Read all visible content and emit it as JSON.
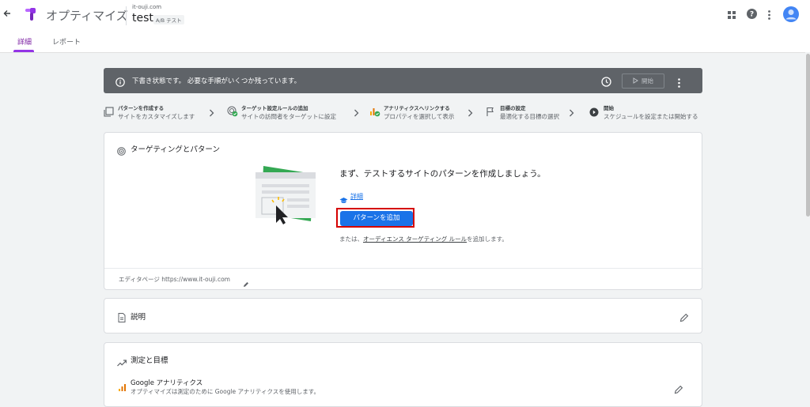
{
  "app": {
    "name": "オプティマイズ",
    "domain": "it-ouji.com",
    "experiment_name": "test",
    "experiment_type": "A/B テスト"
  },
  "tabs": [
    {
      "label": "詳細",
      "active": true
    },
    {
      "label": "レポート",
      "active": false
    }
  ],
  "banner": {
    "message": "下書き状態です。 必要な手順がいくつか残っています。",
    "start_label": "開始"
  },
  "steps": [
    {
      "title": "パターンを作成する",
      "desc": "サイトをカスタマイズします",
      "icon": "pattern-icon"
    },
    {
      "title": "ターゲット設定ルールの追加",
      "desc": "サイトの訪問者をターゲットに設定",
      "icon": "target-check-icon"
    },
    {
      "title": "アナリティクスへリンクする",
      "desc": "プロパティを選択して表示",
      "icon": "analytics-check-icon"
    },
    {
      "title": "目標の設定",
      "desc": "最適化する目標の選択",
      "icon": "flag-icon"
    },
    {
      "title": "開始",
      "desc": "スケジュールを設定または開始する",
      "icon": "play-circle-icon"
    }
  ],
  "targeting_card": {
    "title": "ターゲティングとパターン",
    "heading": "まず、テストするサイトのパターンを作成しましょう。",
    "detail_link": "詳細",
    "add_button": "パターンを追加",
    "or_prefix": "または、",
    "or_link": "オーディエンス ターゲティング ルール",
    "or_suffix": "を追加します。",
    "editor_page": "エディタページ https://www.it-ouji.com"
  },
  "description_card": {
    "title": "説明"
  },
  "measure_card": {
    "title": "測定と目標",
    "ga_title": "Google アナリティクス",
    "ga_desc": "オプティマイズは測定のために Google アナリティクスを使用します。"
  },
  "colors": {
    "brand_purple": "#9334e6",
    "primary_blue": "#1a73e8",
    "banner_gray": "#5f6368",
    "highlight_red": "#d50000"
  }
}
